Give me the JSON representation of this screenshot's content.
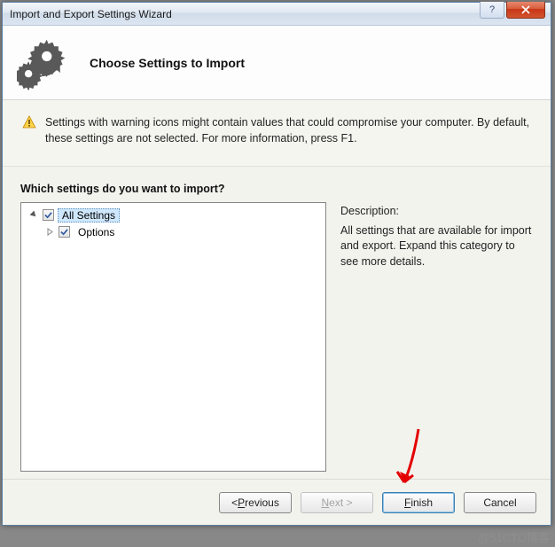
{
  "window": {
    "title": "Import and Export Settings Wizard"
  },
  "header": {
    "heading": "Choose Settings to Import"
  },
  "info": {
    "text": "Settings with warning icons might contain values that could compromise your computer. By default, these settings are not selected. For more information, press F1."
  },
  "content": {
    "question": "Which settings do you want to import?",
    "tree": {
      "root": {
        "label": "All Settings",
        "checked": true,
        "expanded": true,
        "selected": true
      },
      "child1": {
        "label": "Options",
        "checked": true,
        "expanded": false
      }
    },
    "description": {
      "heading": "Description:",
      "body": "All settings that are available for import and export. Expand this category to see more details."
    }
  },
  "buttons": {
    "previous": "Previous",
    "next": "Next",
    "finish": "Finish",
    "cancel": "Cancel"
  },
  "watermark": "@51CTO博客"
}
